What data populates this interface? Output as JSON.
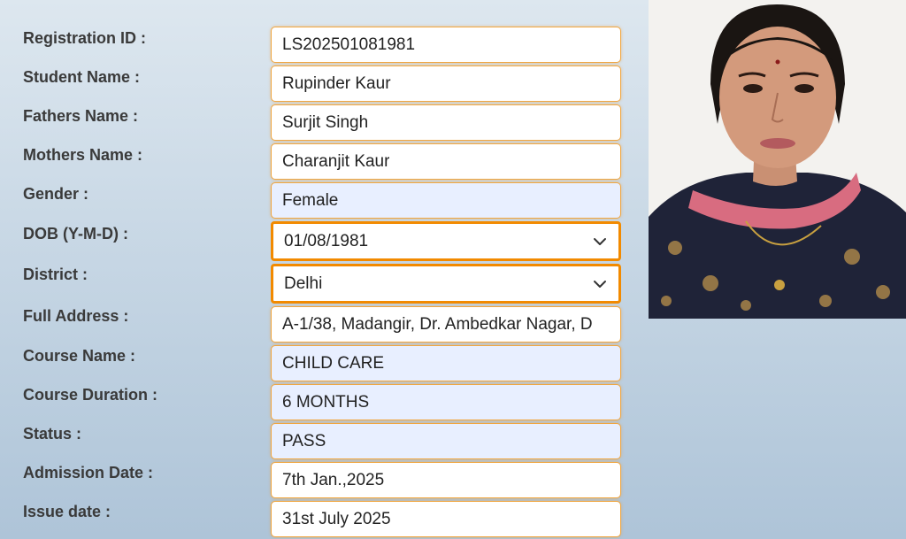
{
  "form": {
    "fields": [
      {
        "label": "Registration ID :",
        "value": "LS202501081981"
      },
      {
        "label": "Student Name :",
        "value": "Rupinder Kaur"
      },
      {
        "label": "Fathers Name :",
        "value": "Surjit Singh"
      },
      {
        "label": "Mothers Name :",
        "value": "Charanjit Kaur"
      },
      {
        "label": "Gender :",
        "value": "Female"
      },
      {
        "label": "DOB (Y-M-D) :",
        "value": "01/08/1981"
      },
      {
        "label": "District :",
        "value": "Delhi"
      },
      {
        "label": "Full Address :",
        "value": "A-1/38, Madangir, Dr. Ambedkar Nagar, D"
      },
      {
        "label": "Course Name :",
        "value": "CHILD CARE"
      },
      {
        "label": "Course Duration :",
        "value": "6 MONTHS"
      },
      {
        "label": "Status :",
        "value": "PASS"
      },
      {
        "label": "Admission Date :",
        "value": "7th Jan.,2025"
      },
      {
        "label": "Issue date :",
        "value": "31st July 2025"
      }
    ]
  },
  "colors": {
    "field_border": "#f0a640",
    "select_border": "#f28a00",
    "readonly_bg": "#e8efff",
    "label_text": "#3a3a3a"
  },
  "icons": {
    "dropdown": "chevron-down-icon"
  }
}
